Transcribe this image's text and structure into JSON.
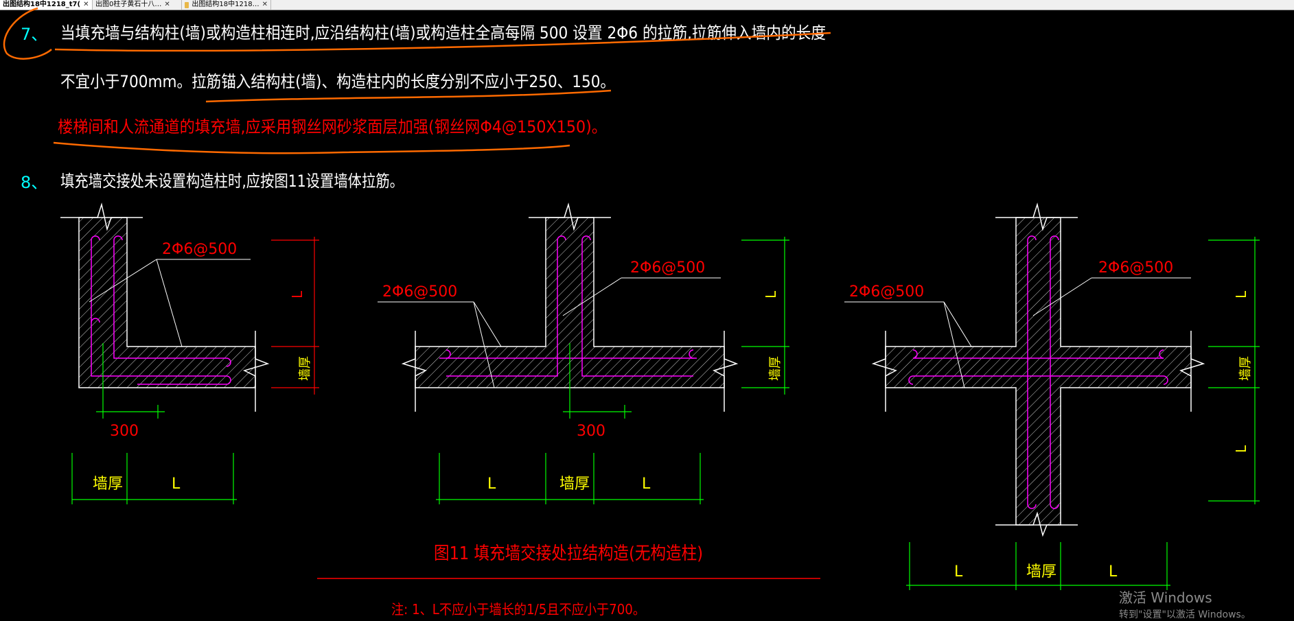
{
  "tabs": [
    {
      "label": "出图结构18中1218_t7(",
      "active": true
    },
    {
      "label": "出图0柱子黄石十八…",
      "active": false
    },
    {
      "label": "出图结构18中1218…",
      "active": false
    }
  ],
  "notes": {
    "n7_num": "7、",
    "n7_line1": "当填充墙与结构柱(墙)或构造柱相连时,应沿结构柱(墙)或构造柱全高每隔 500 设置 2Φ6 的拉筋,拉筋伸入墙内的长度",
    "n7_line2": "不宜小于700mm。拉筋锚入结构柱(墙)、构造柱内的长度分别不应小于250、150。",
    "n7_red": "楼梯间和人流通道的填充墙,应采用钢丝网砂浆面层加强(钢丝网Φ4@150X150)。",
    "n8_num": "8、",
    "n8_text": "填充墙交接处未设置构造柱时,应按图11设置墙体拉筋。"
  },
  "figure": {
    "rebar_label": "2Φ6@500",
    "dim_300": "300",
    "dim_L": "L",
    "dim_thick": "墙厚",
    "caption": "图11  填充墙交接处拉结构造(无构造柱)",
    "note": "注:  1、L不应小于墙长的1/5且不应小于700。"
  },
  "watermark": {
    "line1": "激活 Windows",
    "line2": "转到\"设置\"以激活 Windows。"
  },
  "colors": {
    "background": "#000000",
    "text_white": "#ffffff",
    "text_cyan": "#00ffff",
    "text_red": "#ff0000",
    "text_yellow": "#ffff00",
    "rebar_magenta": "#ff00ff",
    "dim_green": "#00ff00",
    "annotation_orange": "#ff6a00"
  }
}
